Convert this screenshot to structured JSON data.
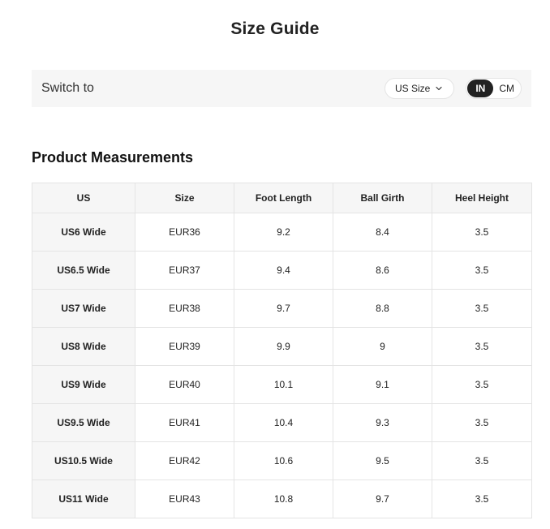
{
  "page_title": "Size Guide",
  "switch_bar": {
    "label": "Switch to",
    "size_select": {
      "selected": "US Size"
    },
    "unit_toggle": {
      "options": [
        "IN",
        "CM"
      ],
      "active": "IN"
    }
  },
  "section_title": "Product Measurements",
  "table": {
    "headers": [
      "US",
      "Size",
      "Foot Length",
      "Ball Girth",
      "Heel Height"
    ],
    "rows": [
      [
        "US6 Wide",
        "EUR36",
        "9.2",
        "8.4",
        "3.5"
      ],
      [
        "US6.5 Wide",
        "EUR37",
        "9.4",
        "8.6",
        "3.5"
      ],
      [
        "US7 Wide",
        "EUR38",
        "9.7",
        "8.8",
        "3.5"
      ],
      [
        "US8 Wide",
        "EUR39",
        "9.9",
        "9",
        "3.5"
      ],
      [
        "US9 Wide",
        "EUR40",
        "10.1",
        "9.1",
        "3.5"
      ],
      [
        "US9.5 Wide",
        "EUR41",
        "10.4",
        "9.3",
        "3.5"
      ],
      [
        "US10.5 Wide",
        "EUR42",
        "10.6",
        "9.5",
        "3.5"
      ],
      [
        "US11 Wide",
        "EUR43",
        "10.8",
        "9.7",
        "3.5"
      ]
    ]
  },
  "icons": {
    "size_select_chevron": "chevron-down-icon"
  },
  "colors": {
    "active_toggle_bg": "#222222",
    "panel_bg": "#f6f6f6",
    "border": "#e4e4e4"
  }
}
